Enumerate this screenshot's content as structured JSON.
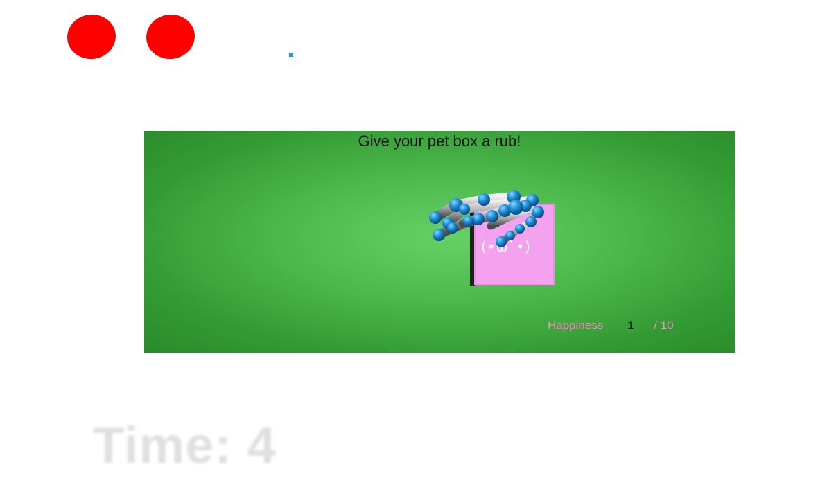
{
  "indicators": [
    {
      "name": "left",
      "color": "#ff0000"
    },
    {
      "name": "right",
      "color": "#ff0000"
    }
  ],
  "marker": {
    "color": "#2a8fe6"
  },
  "game": {
    "instruction": "Give your pet box a rub!",
    "background_color": "#4fbb4f",
    "pet_box": {
      "face": "(•ω`•)",
      "color": "#f4a2ef"
    },
    "hand": {
      "icon": "hand-skeleton-icon",
      "joint_color": "#1b8fd6",
      "bone_color": "#a9a9a9"
    },
    "happiness": {
      "label": "Happiness",
      "value": "1",
      "max_label": "/ 10"
    }
  },
  "timer": {
    "text": "Time: 4"
  }
}
